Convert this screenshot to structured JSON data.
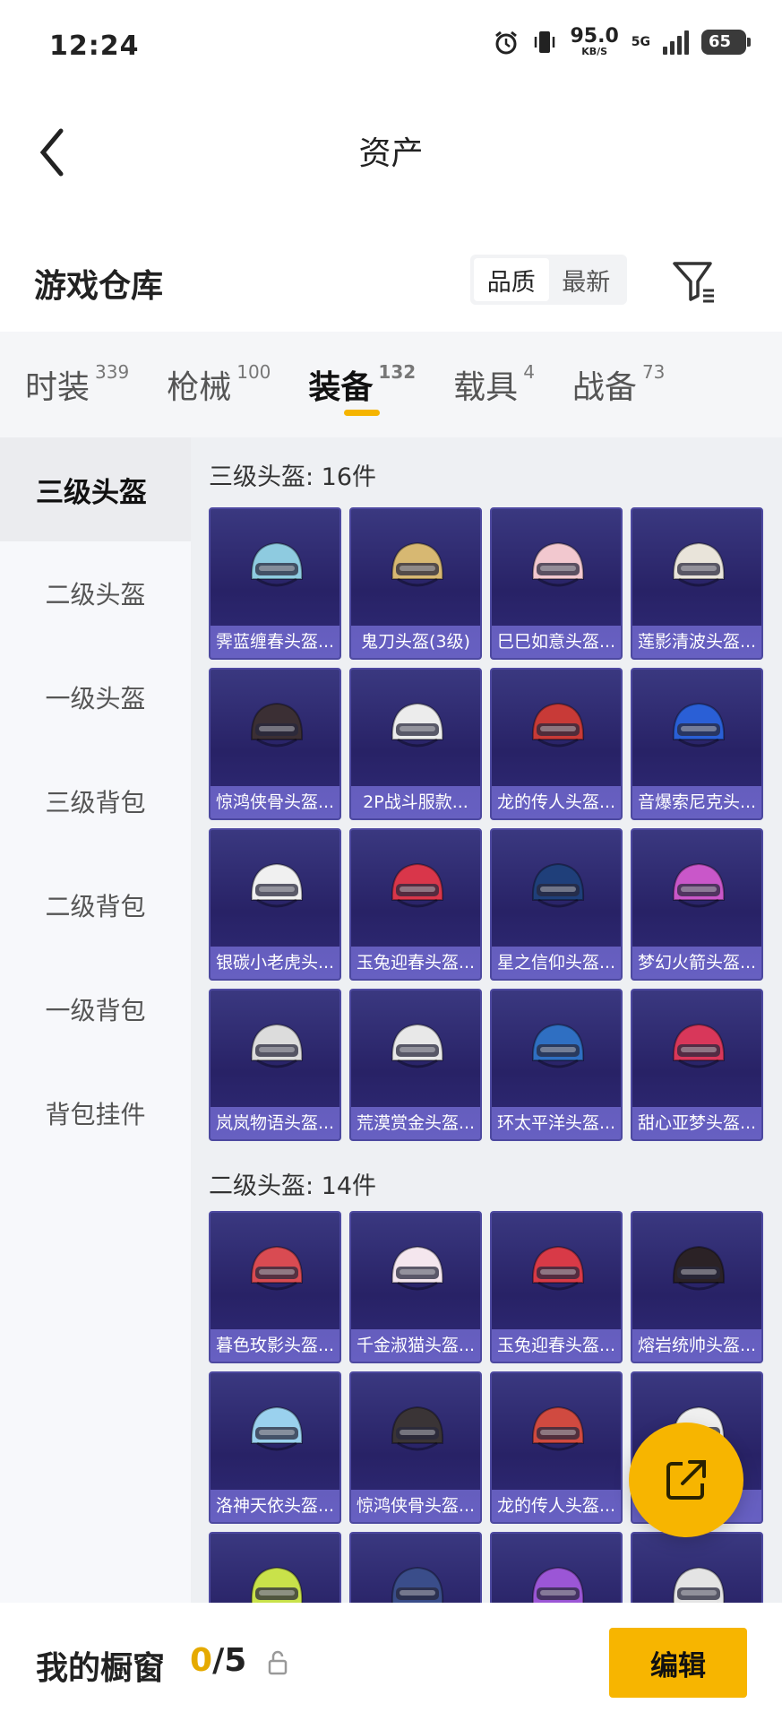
{
  "status_bar": {
    "time": "12:24",
    "speed": "95.0",
    "speed_unit": "KB/S",
    "net": "5G",
    "battery": "65"
  },
  "nav": {
    "title": "资产"
  },
  "header": {
    "title": "游戏仓库",
    "sort_quality": "品质",
    "sort_latest": "最新"
  },
  "tabs": [
    {
      "label": "时装",
      "count": "339"
    },
    {
      "label": "枪械",
      "count": "100"
    },
    {
      "label": "装备",
      "count": "132"
    },
    {
      "label": "载具",
      "count": "4"
    },
    {
      "label": "战备",
      "count": "73"
    }
  ],
  "sidebar": [
    "三级头盔",
    "二级头盔",
    "一级头盔",
    "三级背包",
    "二级背包",
    "一级背包",
    "背包挂件"
  ],
  "sections": [
    {
      "title": "三级头盔: 16件",
      "items": [
        {
          "name": "霁蓝缠春头盔...",
          "color": "#8ecbe0"
        },
        {
          "name": "鬼刀头盔(3级)",
          "color": "#d7b872"
        },
        {
          "name": "巳巳如意头盔...",
          "color": "#f2c8cf"
        },
        {
          "name": "莲影清波头盔...",
          "color": "#e9e4da"
        },
        {
          "name": "惊鸿侠骨头盔...",
          "color": "#3b2f34"
        },
        {
          "name": "2P战斗服款...",
          "color": "#ececec"
        },
        {
          "name": "龙的传人头盔...",
          "color": "#c83a37"
        },
        {
          "name": "音爆索尼克头...",
          "color": "#2a5fd6"
        },
        {
          "name": "银碳小老虎头...",
          "color": "#f0f0f0"
        },
        {
          "name": "玉兔迎春头盔...",
          "color": "#d9364a"
        },
        {
          "name": "星之信仰头盔...",
          "color": "#1f3f7a"
        },
        {
          "name": "梦幻火箭头盔...",
          "color": "#c957c9"
        },
        {
          "name": "岚岚物语头盔...",
          "color": "#dcdcdc"
        },
        {
          "name": "荒漠赏金头盔...",
          "color": "#e8e8e8"
        },
        {
          "name": "环太平洋头盔...",
          "color": "#2f6fc2"
        },
        {
          "name": "甜心亚梦头盔...",
          "color": "#d8375a"
        }
      ]
    },
    {
      "title": "二级头盔: 14件",
      "items": [
        {
          "name": "暮色玫影头盔...",
          "color": "#d94b52"
        },
        {
          "name": "千金淑猫头盔...",
          "color": "#f4e6ee"
        },
        {
          "name": "玉兔迎春头盔...",
          "color": "#d83a47"
        },
        {
          "name": "熔岩统帅头盔...",
          "color": "#2b2226"
        },
        {
          "name": "洛神天依头盔...",
          "color": "#9ad1ee"
        },
        {
          "name": "惊鸿侠骨头盔...",
          "color": "#3a3436"
        },
        {
          "name": "龙的传人头盔...",
          "color": "#d04a40"
        },
        {
          "name": "",
          "color": "#efefef"
        },
        {
          "name": "",
          "color": "#c9e24a"
        },
        {
          "name": "",
          "color": "#3a4d8a"
        },
        {
          "name": "",
          "color": "#9b56d6"
        },
        {
          "name": "",
          "color": "#e4e4e4"
        }
      ]
    }
  ],
  "bottom": {
    "label": "我的橱窗",
    "count_used": "0",
    "count_total": "/5",
    "edit": "编辑"
  }
}
